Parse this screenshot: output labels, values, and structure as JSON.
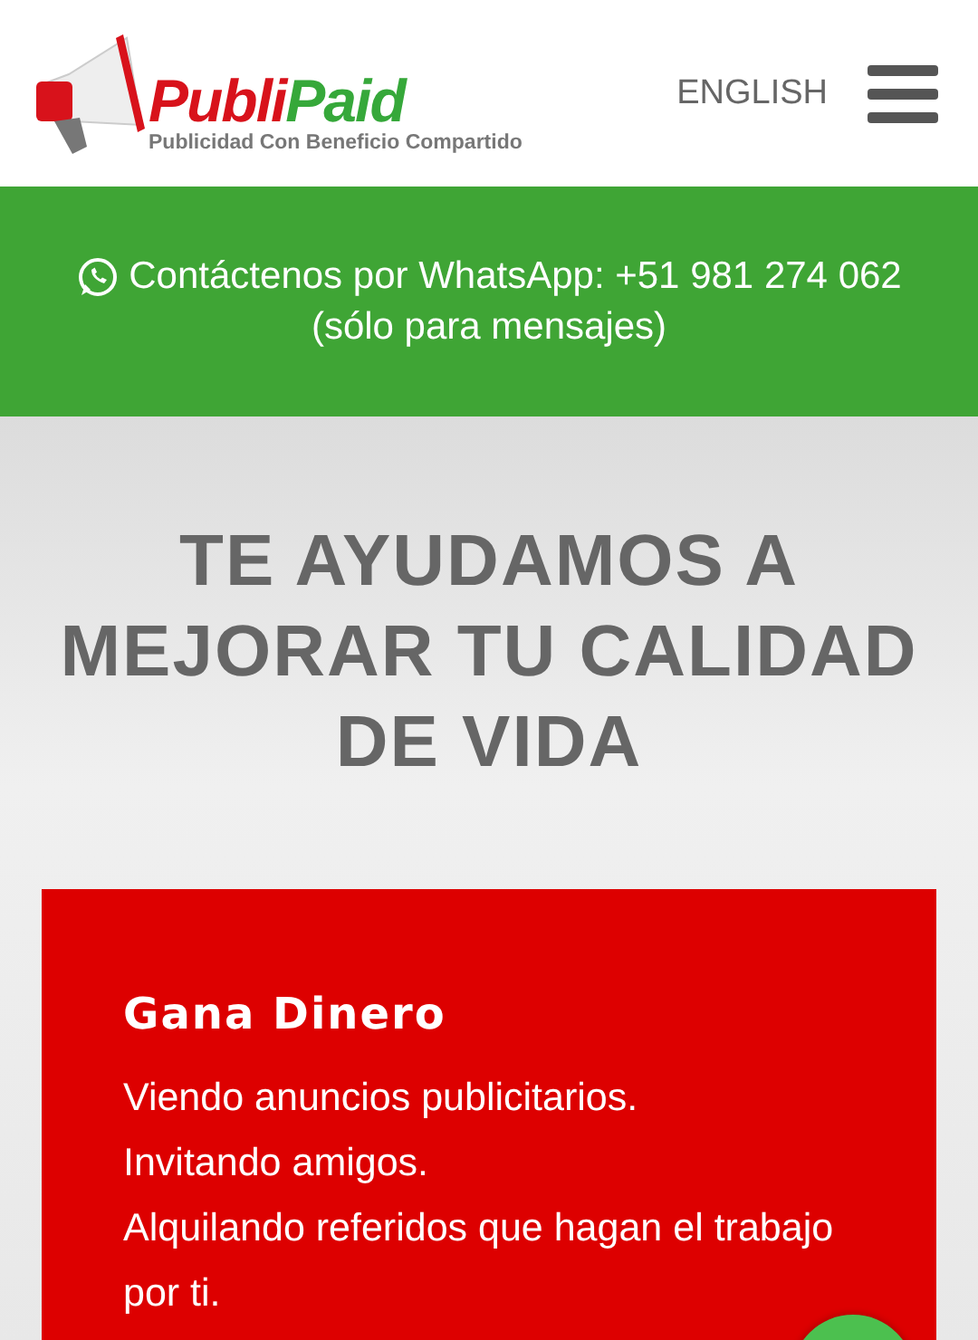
{
  "header": {
    "logo": {
      "part_red": "Publi",
      "part_green": "Paid",
      "tagline": "Publicidad Con Beneficio Compartido"
    },
    "language_link": "ENGLISH"
  },
  "contact_banner": {
    "text": "Contáctenos por WhatsApp: +51 981 274 062",
    "note": "(sólo para mensajes)"
  },
  "hero": {
    "heading": "TE AYUDAMOS A MEJORAR TU CALIDAD DE VIDA"
  },
  "card": {
    "title": "Gana Dinero",
    "lines": [
      "Viendo anuncios publicitarios.",
      "Invitando amigos.",
      "Alquilando referidos que hagan el trabajo por ti."
    ]
  }
}
